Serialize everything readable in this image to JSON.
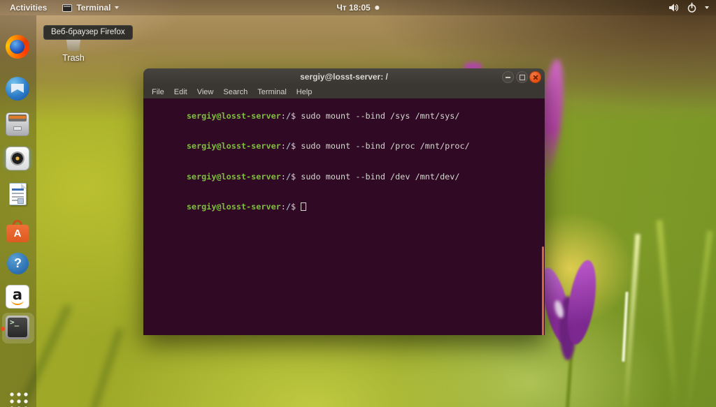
{
  "top_bar": {
    "activities_label": "Activities",
    "focused_app_label": "Terminal",
    "clock_text": "Чт 18:05"
  },
  "desktop": {
    "firefox_tooltip": "Веб-браузер Firefox",
    "trash_label": "Trash"
  },
  "dock": {
    "terminal_glyph": ">_",
    "software_letter": "A",
    "help_glyph": "?",
    "amazon_letter": "a"
  },
  "window": {
    "title": "sergiy@losst-server: /",
    "menu_items": [
      "File",
      "Edit",
      "View",
      "Search",
      "Terminal",
      "Help"
    ],
    "terminal": {
      "prompt_user": "sergiy@losst-server",
      "prompt_colon": ":",
      "prompt_path": "/",
      "prompt_dollar": "$ ",
      "commands": [
        "sudo mount --bind /sys /mnt/sys/",
        "sudo mount --bind /proc /mnt/proc/",
        "sudo mount --bind /dev /mnt/dev/",
        ""
      ]
    }
  },
  "colors": {
    "terminal_background": "#300a24",
    "prompt_green": "#7dbe3b",
    "terminal_foreground": "#d3d7cf",
    "titlebar": "#3a3733",
    "close_button": "#e65113",
    "scrollbar_thumb": "#d4653c",
    "panel_text": "#f2efe9"
  }
}
